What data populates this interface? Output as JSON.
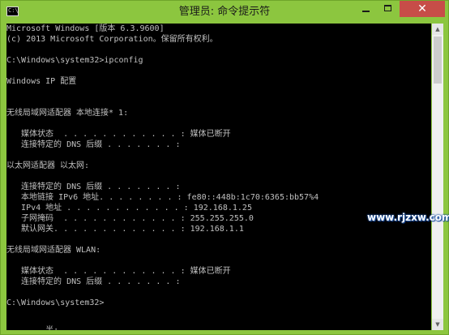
{
  "window": {
    "title": "管理员: 命令提示符",
    "icon": "cmd-icon",
    "icon_text": "C:\\",
    "close_glyph": "✕"
  },
  "console": {
    "lines": [
      "Microsoft Windows [版本 6.3.9600]",
      "(c) 2013 Microsoft Corporation。保留所有权利。",
      "",
      "C:\\Windows\\system32>ipconfig",
      "",
      "Windows IP 配置",
      "",
      "",
      "无线局域网适配器 本地连接* 1:",
      "",
      "   媒体状态  . . . . . . . . . . . . : 媒体已断开",
      "   连接特定的 DNS 后缀 . . . . . . . :",
      "",
      "以太网适配器 以太网:",
      "",
      "   连接特定的 DNS 后缀 . . . . . . . :",
      "   本地链接 IPv6 地址. . . . . . . . : fe80::448b:1c70:6365:bb57%4",
      "   IPv4 地址 . . . . . . . . . . . . : 192.168.1.25",
      "   子网掩码  . . . . . . . . . . . . : 255.255.255.0",
      "   默认网关. . . . . . . . . . . . . : 192.168.1.1",
      "",
      "无线局域网适配器 WLAN:",
      "",
      "   媒体状态  . . . . . . . . . . . . : 媒体已断开",
      "   连接特定的 DNS 后缀 . . . . . . . :",
      "",
      "C:\\Windows\\system32>",
      "",
      "",
      "        半:"
    ]
  },
  "watermark": {
    "text": "www.rjzxw.com"
  },
  "colors": {
    "titlebar": "#8cc63f",
    "console_bg": "#000000",
    "console_text": "#c0c0c0",
    "close_button": "#c74d48"
  }
}
